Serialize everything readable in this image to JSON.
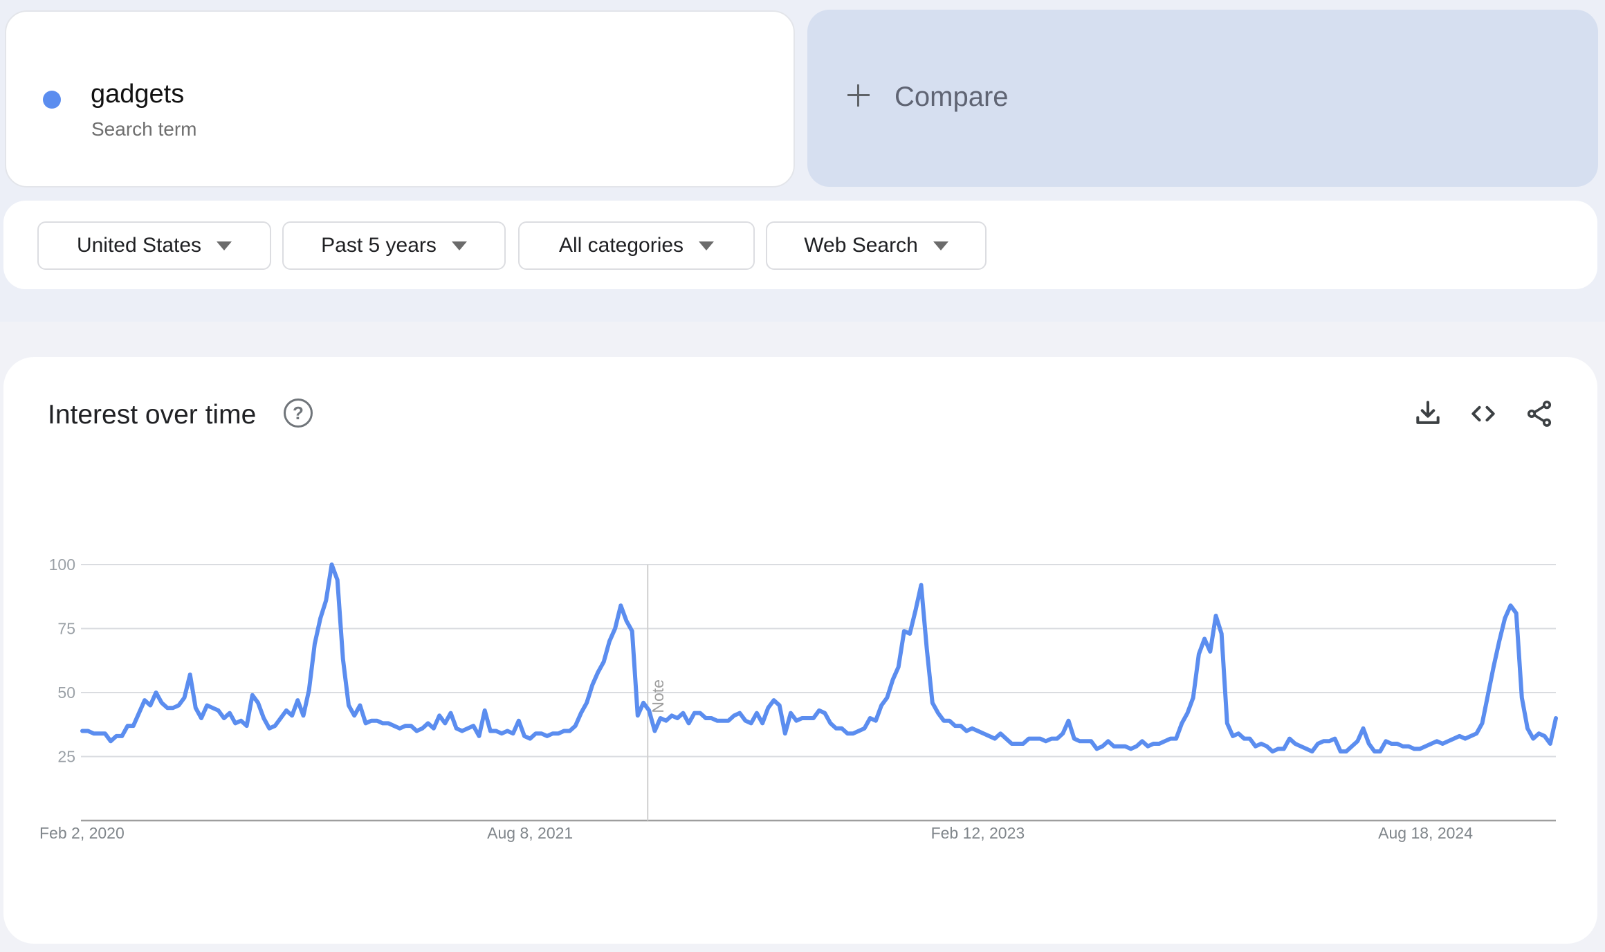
{
  "search_term": {
    "name": "gadgets",
    "subtitle": "Search term",
    "color": "#5b8def"
  },
  "compare": {
    "label": "Compare",
    "icon": "plus-icon"
  },
  "filters": [
    {
      "label": "United States",
      "icon": "caret-down-icon"
    },
    {
      "label": "Past 5 years",
      "icon": "caret-down-icon"
    },
    {
      "label": "All categories",
      "icon": "caret-down-icon"
    },
    {
      "label": "Web Search",
      "icon": "caret-down-icon"
    }
  ],
  "chart_panel": {
    "title": "Interest over time",
    "help_icon": "help-circle-icon",
    "help_glyph": "?",
    "actions": [
      "download-icon",
      "embed-code-icon",
      "share-icon"
    ]
  },
  "chart_data": {
    "type": "line",
    "title": "Interest over time",
    "xlabel": "",
    "ylabel": "",
    "ylim": [
      0,
      100
    ],
    "yticks": [
      25,
      50,
      75,
      100
    ],
    "grid": true,
    "x_start": "Feb 2, 2020",
    "x_interval": "weekly",
    "xtick_labels": [
      {
        "label": "Feb 2, 2020",
        "index": 0
      },
      {
        "label": "Aug 8, 2021",
        "index": 79
      },
      {
        "label": "Feb 12, 2023",
        "index": 158
      },
      {
        "label": "Aug 18, 2024",
        "index": 237
      }
    ],
    "annotations": [
      {
        "label": "Note",
        "index": 100
      }
    ],
    "series": [
      {
        "name": "gadgets",
        "color": "#5b8def",
        "values": [
          35,
          35,
          34,
          34,
          34,
          31,
          33,
          33,
          37,
          37,
          42,
          47,
          45,
          50,
          46,
          44,
          44,
          45,
          48,
          57,
          44,
          40,
          45,
          44,
          43,
          40,
          42,
          38,
          39,
          37,
          49,
          46,
          40,
          36,
          37,
          40,
          43,
          41,
          47,
          41,
          51,
          69,
          79,
          86,
          100,
          94,
          63,
          45,
          41,
          45,
          38,
          39,
          39,
          38,
          38,
          37,
          36,
          37,
          37,
          35,
          36,
          38,
          36,
          41,
          38,
          42,
          36,
          35,
          36,
          37,
          33,
          43,
          35,
          35,
          34,
          35,
          34,
          39,
          33,
          32,
          34,
          34,
          33,
          34,
          34,
          35,
          35,
          37,
          42,
          46,
          53,
          58,
          62,
          70,
          75,
          84,
          78,
          74,
          41,
          46,
          43,
          35,
          40,
          39,
          41,
          40,
          42,
          38,
          42,
          42,
          40,
          40,
          39,
          39,
          39,
          41,
          42,
          39,
          38,
          42,
          38,
          44,
          47,
          45,
          34,
          42,
          39,
          40,
          40,
          40,
          43,
          42,
          38,
          36,
          36,
          34,
          34,
          35,
          36,
          40,
          39,
          45,
          48,
          55,
          60,
          74,
          73,
          82,
          92,
          67,
          46,
          42,
          39,
          39,
          37,
          37,
          35,
          36,
          35,
          34,
          33,
          32,
          34,
          32,
          30,
          30,
          30,
          32,
          32,
          32,
          31,
          32,
          32,
          34,
          39,
          32,
          31,
          31,
          31,
          28,
          29,
          31,
          29,
          29,
          29,
          28,
          29,
          31,
          29,
          30,
          30,
          31,
          32,
          32,
          38,
          42,
          48,
          65,
          71,
          66,
          80,
          73,
          38,
          33,
          34,
          32,
          32,
          29,
          30,
          29,
          27,
          28,
          28,
          32,
          30,
          29,
          28,
          27,
          30,
          31,
          31,
          32,
          27,
          27,
          29,
          31,
          36,
          30,
          27,
          27,
          31,
          30,
          30,
          29,
          29,
          28,
          28,
          29,
          30,
          31,
          30,
          31,
          32,
          33,
          32,
          33,
          34,
          38,
          49,
          60,
          70,
          79,
          84,
          81,
          48,
          36,
          32,
          34,
          33,
          30,
          40
        ]
      }
    ]
  }
}
